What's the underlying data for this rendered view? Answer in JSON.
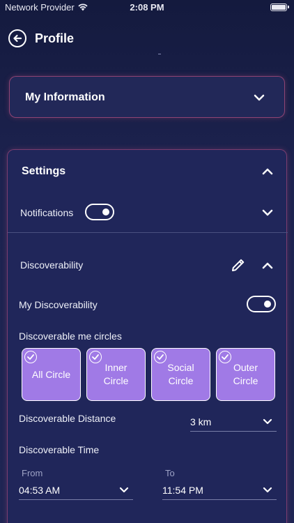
{
  "status_bar": {
    "carrier": "Network Provider",
    "time": "2:08 PM"
  },
  "header": {
    "title": "Profile"
  },
  "my_information": {
    "title": "My Information"
  },
  "settings": {
    "title": "Settings",
    "notifications_label": "Notifications",
    "notifications_on": true,
    "discoverability_label": "Discoverability",
    "my_discoverability_label": "My Discoverability",
    "my_discoverability_on": true,
    "circles_label": "Discoverable me circles",
    "circles": [
      {
        "label": "All Circle",
        "checked": true
      },
      {
        "label": "Inner Circle",
        "checked": true
      },
      {
        "label": "Social Circle",
        "checked": true
      },
      {
        "label": "Outer Circle",
        "checked": true
      }
    ],
    "distance_label": "Discoverable Distance",
    "distance_value": "3 km",
    "time_label": "Discoverable Time",
    "from_label": "From",
    "from_value": "04:53 AM",
    "to_label": "To",
    "to_value": "11:54 PM"
  },
  "colors": {
    "background": "#1d2350",
    "card_border": "#e95b8c",
    "circle_fill": "#a07ae6"
  }
}
